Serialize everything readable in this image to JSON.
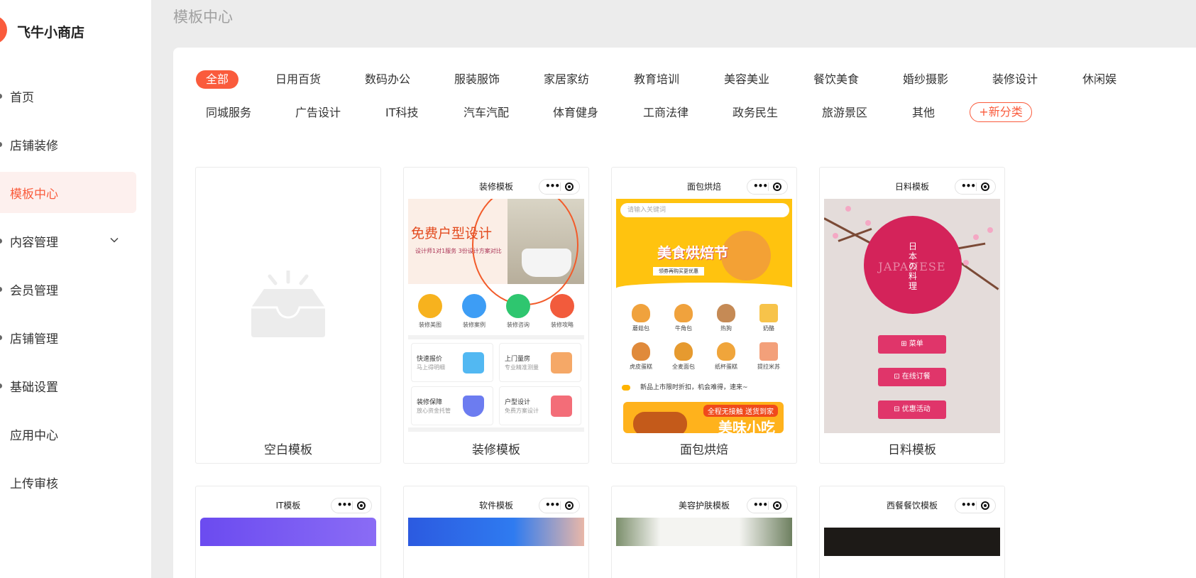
{
  "sidebar": {
    "brand_name": "飞牛小商店",
    "items": [
      {
        "label": "首页"
      },
      {
        "label": "店铺装修"
      },
      {
        "label": "模板中心"
      },
      {
        "label": "内容管理"
      },
      {
        "label": "会员管理"
      },
      {
        "label": "店铺管理"
      },
      {
        "label": "基础设置"
      },
      {
        "label": "应用中心"
      },
      {
        "label": "上传审核"
      }
    ],
    "active_item": "模板中心"
  },
  "header": {
    "title": "模板中心"
  },
  "categories": {
    "row1": [
      "全部",
      "日用百货",
      "数码办公",
      "服装服饰",
      "家居家纺",
      "教育培训",
      "美容美业",
      "餐饮美食",
      "婚纱摄影",
      "装修设计",
      "休闲娱"
    ],
    "row2": [
      "同城服务",
      "广告设计",
      "IT科技",
      "汽车汽配",
      "体育健身",
      "工商法律",
      "政务民生",
      "旅游景区",
      "其他"
    ],
    "add_label": "+新分类",
    "active": "全部"
  },
  "templates": [
    {
      "caption": "空白模板"
    },
    {
      "caption": "装修模板",
      "phone_title": "装修模板",
      "banner_headline": "免费户型设计",
      "banner_sub": "设计师1对1服务 3份设计方案对比",
      "icons": [
        "装修美图",
        "装修案例",
        "装修咨询",
        "装修攻略"
      ],
      "grid": [
        {
          "title": "快速报价",
          "sub": "马上得明细"
        },
        {
          "title": "上门量房",
          "sub": "专业精准测量"
        },
        {
          "title": "装修保障",
          "sub": "放心资金托管"
        },
        {
          "title": "户型设计",
          "sub": "免费方案设计"
        }
      ]
    },
    {
      "caption": "面包烘焙",
      "phone_title": "面包烘焙",
      "search_placeholder": "请输入关键词",
      "banner_headline": "美食烘焙节",
      "banner_pill": "领券再购买更优惠",
      "foods": [
        "蘑菇包",
        "牛角包",
        "热狗",
        "奶酪",
        "虎皮蛋糕",
        "全麦面包",
        "纸杯蛋糕",
        "提拉米苏"
      ],
      "notice": "新品上市限时折扣，机会难得，速来~",
      "promo_tag": "全程无接触 送货到家",
      "promo_big": "美味小吃"
    },
    {
      "caption": "日料模板",
      "phone_title": "日料模板",
      "vertical_text": "日本の料理",
      "latin_text": "JAPANESE",
      "buttons": [
        "菜单",
        "在线订餐",
        "优惠活动"
      ]
    }
  ],
  "templates_row2": [
    {
      "phone_title": "IT模板"
    },
    {
      "phone_title": "软件模板"
    },
    {
      "phone_title": "美容护肤模板"
    },
    {
      "phone_title": "西餐餐饮模板"
    }
  ],
  "colors": {
    "accent": "#fa5b3c",
    "active_bg": "#fdf0ee",
    "page_bg": "#ececec",
    "japanese_red": "#d4235a",
    "bakery_yellow": "#ffc30f"
  },
  "icons": {
    "capsule_more": "more-dots-icon",
    "capsule_close": "target-icon",
    "empty": "inbox-icon",
    "chevron": "chevron-down-icon"
  }
}
